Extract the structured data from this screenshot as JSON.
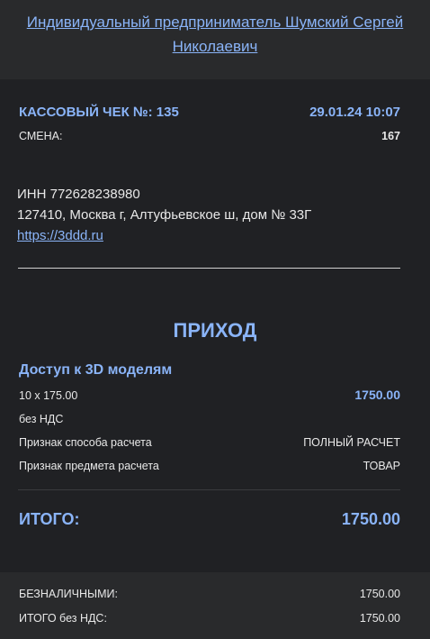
{
  "header": {
    "merchant": "Индивидуальный предприниматель Шумский Сергей Николаевич"
  },
  "receipt": {
    "title": "КАССОВЫЙ ЧЕК №: 135",
    "datetime": "29.01.24 10:07",
    "shift_label": "СМЕНА:",
    "shift_value": "167",
    "inn": "ИНН 772628238980",
    "address": "127410, Москва г, Алтуфьевское ш, дом № 33Г",
    "website": "https://3ddd.ru",
    "operation": "ПРИХОД",
    "item": {
      "name": "Доступ к 3D моделям",
      "qty_price": "10 x 175.00",
      "sum": "1750.00",
      "vat": "без НДС",
      "payment_method_label": "Признак способа расчета",
      "payment_method_value": "ПОЛНЫЙ РАСЧЕТ",
      "subject_label": "Признак предмета расчета",
      "subject_value": "ТОВАР"
    },
    "total_label": "ИТОГО:",
    "total_value": "1750.00"
  },
  "footer": {
    "cashless_label": "БЕЗНАЛИЧНЫМИ:",
    "cashless_value": "1750.00",
    "total_no_vat_label": "ИТОГО без НДС:",
    "total_no_vat_value": "1750.00"
  },
  "colors": {
    "accent": "#8ab4f8",
    "background": "#202124",
    "header_background": "#292a2c",
    "text": "#e8e8e8"
  }
}
